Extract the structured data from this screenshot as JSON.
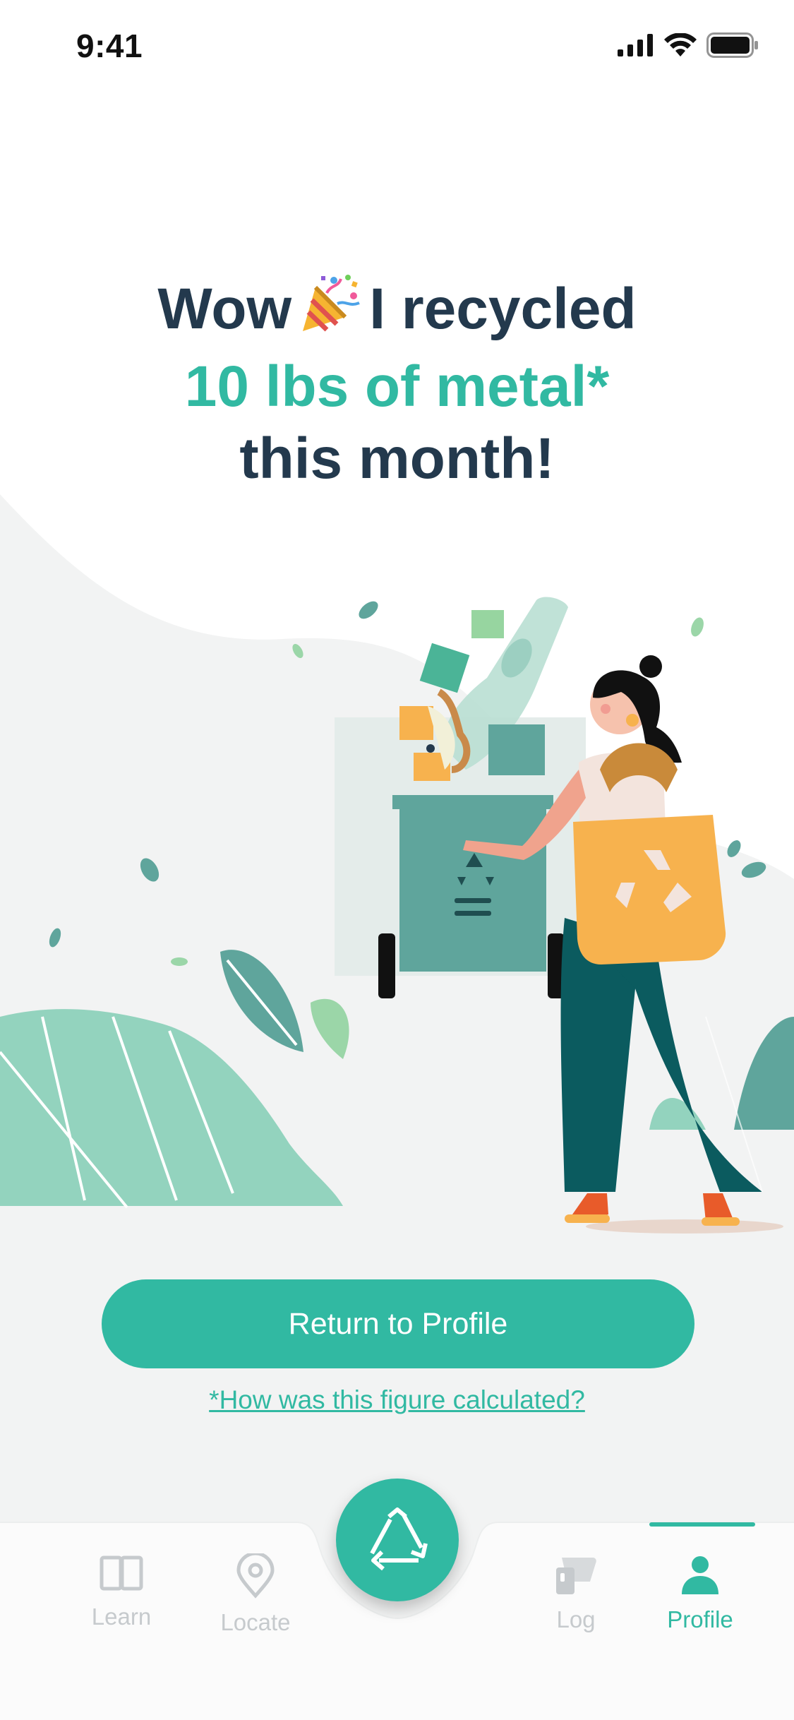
{
  "status_bar": {
    "time": "9:41"
  },
  "headline": {
    "line1_before": "Wow",
    "line1_after": "I recycled",
    "line2": "10 lbs of metal*",
    "line3": "this month!"
  },
  "primary_button": {
    "label": "Return to Profile"
  },
  "footnote_link": {
    "label": "*How was this figure calculated?"
  },
  "tab_bar": {
    "tabs": [
      {
        "label": "Learn",
        "icon": "book-icon",
        "active": false
      },
      {
        "label": "Locate",
        "icon": "map-pin-icon",
        "active": false
      },
      {
        "label": "Log",
        "icon": "log-icon",
        "active": false
      },
      {
        "label": "Profile",
        "icon": "person-icon",
        "active": true
      }
    ],
    "center_action_icon": "recycle-icon"
  },
  "colors": {
    "accent": "#31b9a2",
    "heading": "#23394d",
    "inactive_tab": "#c6cacd",
    "background_curve": "#f2f3f3"
  }
}
